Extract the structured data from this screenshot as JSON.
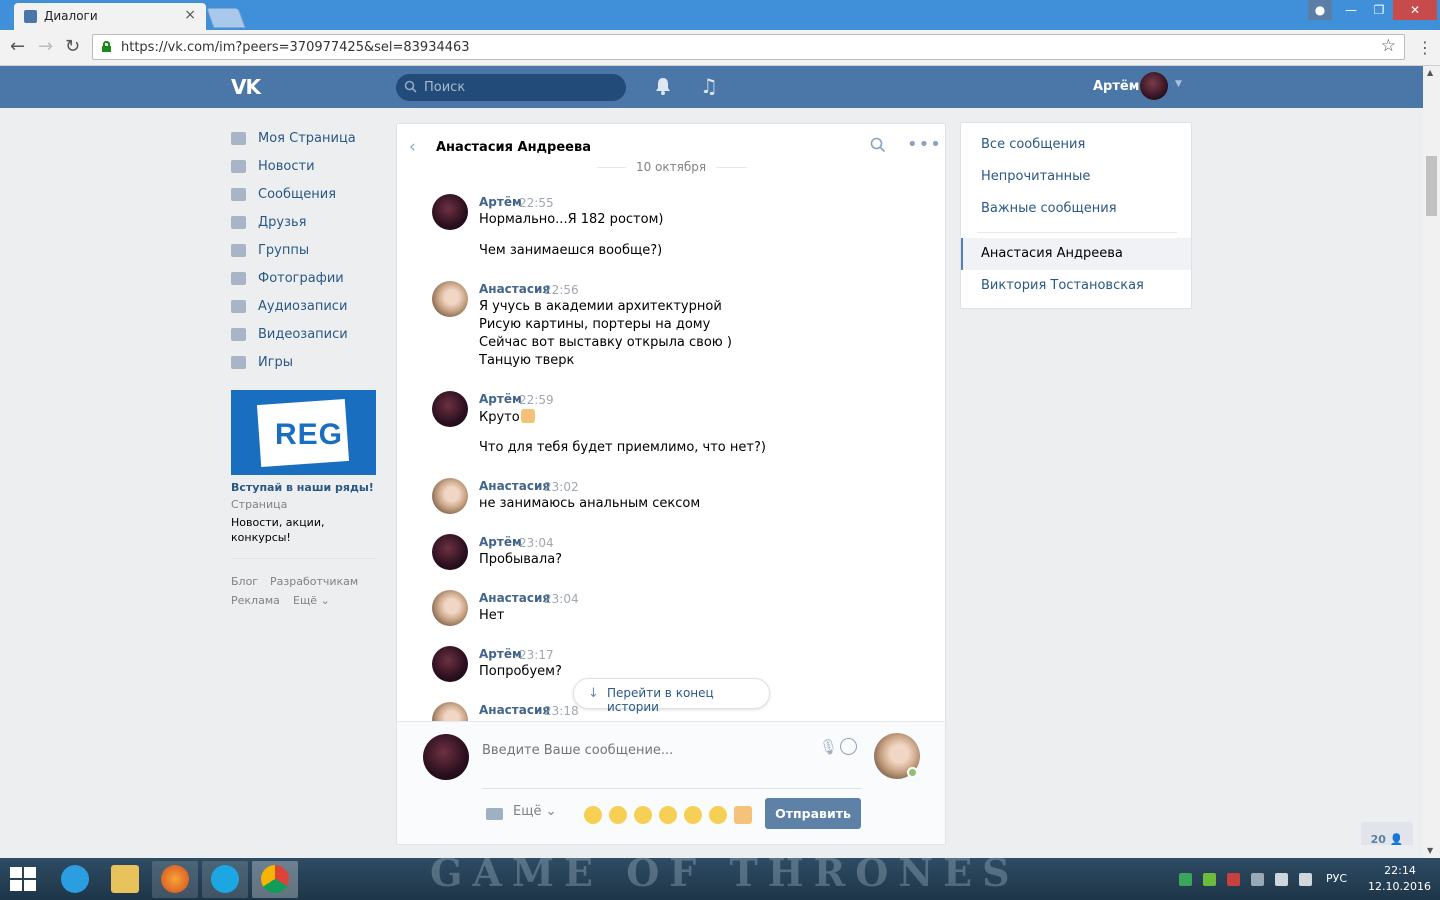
{
  "browser": {
    "tab_title": "Диалоги",
    "tab_close": "×",
    "url": "https://vk.com/im?peers=370977425&sel=83934463"
  },
  "header": {
    "logo": "VK",
    "search_placeholder": "Поиск",
    "user_name": "Артём"
  },
  "leftnav": {
    "items": [
      {
        "label": "Моя Страница",
        "icon": "home-icon"
      },
      {
        "label": "Новости",
        "icon": "news-icon"
      },
      {
        "label": "Сообщения",
        "icon": "messages-icon"
      },
      {
        "label": "Друзья",
        "icon": "friends-icon"
      },
      {
        "label": "Группы",
        "icon": "groups-icon"
      },
      {
        "label": "Фотографии",
        "icon": "photos-icon"
      },
      {
        "label": "Аудиозаписи",
        "icon": "audio-icon"
      },
      {
        "label": "Видеозаписи",
        "icon": "video-icon"
      },
      {
        "label": "Игры",
        "icon": "games-icon"
      }
    ],
    "ad": {
      "logo_text": "REG",
      "title": "Вступай в наши ряды!",
      "subtitle": "Страница",
      "description": "Новости, акции, конкурсы!"
    },
    "footer": {
      "blog": "Блог",
      "developers": "Разработчикам",
      "ads": "Реклама",
      "more": "Ещё ⌄"
    }
  },
  "chat": {
    "title": "Анастасия Андреева",
    "date_separator": "10 октября",
    "jump_to_end": "Перейти в конец истории",
    "composer": {
      "placeholder": "Введите Ваше сообщение...",
      "more_label": "Ещё ⌄",
      "send_label": "Отправить"
    },
    "messages": [
      {
        "author": "Артём",
        "time": "22:55",
        "who": "me",
        "lines": [
          "Нормально...Я 182 ростом)",
          "",
          "Чем занимаешся вообще?)"
        ]
      },
      {
        "author": "Анастасия",
        "time": "22:56",
        "who": "peer",
        "lines": [
          "Я учусь в академии архитектурной",
          "Рисую картины, портеры на дому",
          "Сейчас вот выставку открыла свою )",
          "Танцую тверк"
        ]
      },
      {
        "author": "Артём",
        "time": "22:59",
        "who": "me",
        "lines": [
          "Круто",
          "",
          "Что для тебя будет приемлимо, что нет?)"
        ]
      },
      {
        "author": "Анастасия",
        "time": "23:02",
        "who": "peer",
        "lines": [
          "не занимаюсь анальным сексом"
        ]
      },
      {
        "author": "Артём",
        "time": "23:04",
        "who": "me",
        "lines": [
          "Пробывала?"
        ]
      },
      {
        "author": "Анастасия",
        "time": "23:04",
        "who": "peer",
        "lines": [
          "Нет"
        ]
      },
      {
        "author": "Артём",
        "time": "23:17",
        "who": "me",
        "lines": [
          "Попробуем?"
        ]
      },
      {
        "author": "Анастасия",
        "time": "23:18",
        "who": "peer",
        "lines": []
      }
    ]
  },
  "rightpanel": {
    "all": "Все сообщения",
    "unread": "Непрочитанные",
    "important": "Важные сообщения",
    "dialogs": [
      "Анастасия Андреева",
      "Виктория Тостановская"
    ]
  },
  "online_count": "20",
  "taskbar": {
    "wallpaper_text": "GAME OF THRONES",
    "lang": "РУС",
    "time": "22:14",
    "date": "12.10.2016"
  },
  "colors": {
    "vk_blue": "#4a76a8",
    "link": "#2a5885",
    "send_button": "#5e81a8"
  }
}
